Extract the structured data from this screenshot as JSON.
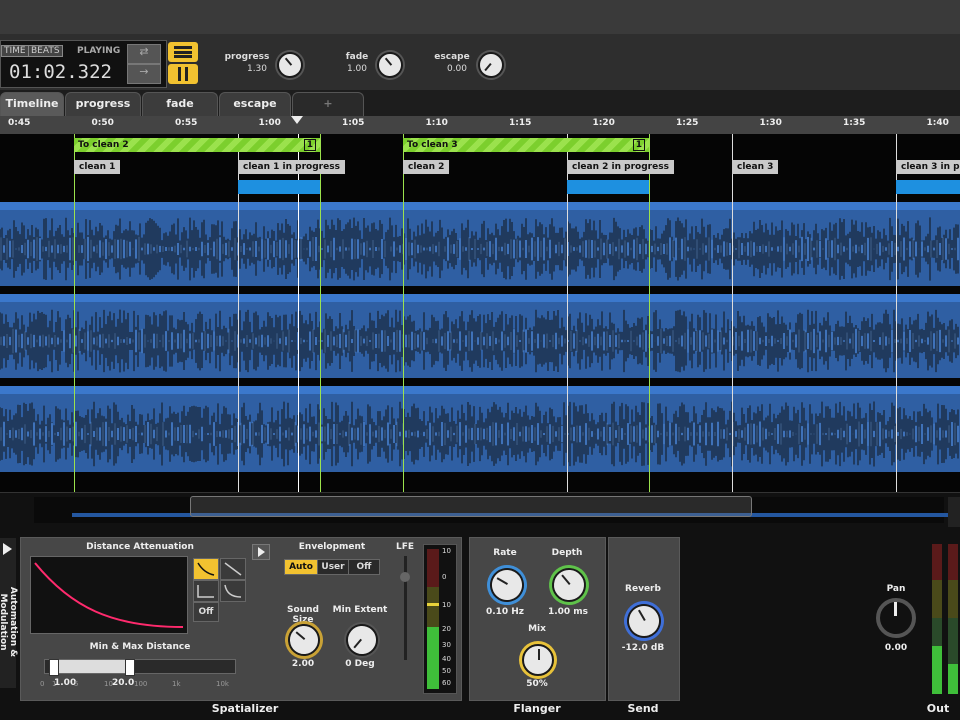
{
  "transport": {
    "time_label": "TIME",
    "beats_label": "BEATS",
    "status": "PLAYING",
    "clock": "01:02.322",
    "knobs": [
      {
        "label": "progress",
        "value": "1.30"
      },
      {
        "label": "fade",
        "value": "1.00"
      },
      {
        "label": "escape",
        "value": "0.00"
      }
    ]
  },
  "tabs": [
    {
      "label": "Timeline"
    },
    {
      "label": "progress"
    },
    {
      "label": "fade"
    },
    {
      "label": "escape"
    },
    {
      "label": "+"
    }
  ],
  "ruler": [
    "0:45",
    "0:50",
    "0:55",
    "1:00",
    "1:05",
    "1:10",
    "1:15",
    "1:20",
    "1:25",
    "1:30",
    "1:35",
    "1:40"
  ],
  "regions": [
    {
      "label": "To clean 2",
      "count": "1"
    },
    {
      "label": "To clean 3",
      "count": "1"
    }
  ],
  "markers": [
    "clean 1",
    "clean 1 in progress",
    "clean 2",
    "clean 2 in progress",
    "clean 3",
    "clean 3 in progress"
  ],
  "side_tab": "Automation & Modulation",
  "spatializer": {
    "distance_title": "Distance Attenuation",
    "off_label": "Off",
    "minmax_title": "Min & Max Distance",
    "min_value": "1.00",
    "max_value": "20.0",
    "scale": [
      "0",
      "1",
      "5",
      "10",
      "100",
      "1k",
      "10k"
    ],
    "envelopment_title": "Envelopment",
    "env_buttons": [
      "Auto",
      "User",
      "Off"
    ],
    "sound_size_label": "Sound Size",
    "sound_size_value": "2.00",
    "min_extent_label": "Min Extent",
    "min_extent_value": "0 Deg",
    "lfe_label": "LFE",
    "meter_scale": [
      "10",
      "0",
      "10",
      "20",
      "30",
      "40",
      "50",
      "60"
    ],
    "section_label": "Spatializer"
  },
  "flanger": {
    "rate_label": "Rate",
    "rate_value": "0.10 Hz",
    "depth_label": "Depth",
    "depth_value": "1.00 ms",
    "mix_label": "Mix",
    "mix_value": "50%",
    "section_label": "Flanger"
  },
  "send": {
    "reverb_label": "Reverb",
    "reverb_value": "-12.0 dB",
    "section_label": "Send"
  },
  "out": {
    "pan_label": "Pan",
    "pan_value": "0.00",
    "section_label": "Out"
  }
}
